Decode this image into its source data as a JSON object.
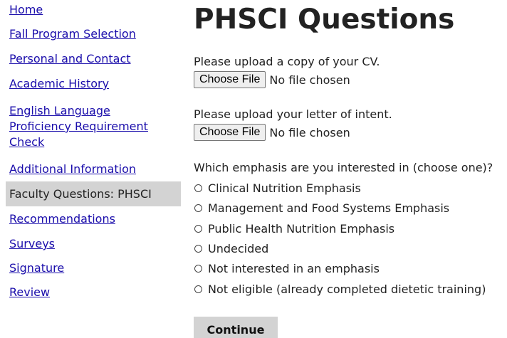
{
  "sidebar": {
    "items": [
      {
        "label": "Home",
        "active": false
      },
      {
        "label": "Fall Program Selection",
        "active": false
      },
      {
        "label": "Personal and Contact",
        "active": false
      },
      {
        "label": "Academic History",
        "active": false
      },
      {
        "label": "English Language Proficiency Requirement Check",
        "active": false
      },
      {
        "label": "Additional Information",
        "active": false
      },
      {
        "label": "Faculty Questions: PHSCI",
        "active": true
      },
      {
        "label": "Recommendations",
        "active": false
      },
      {
        "label": "Surveys",
        "active": false
      },
      {
        "label": "Signature",
        "active": false
      },
      {
        "label": "Review",
        "active": false
      }
    ],
    "english_lines": [
      "English Language",
      "Proficiency Requirement",
      "Check"
    ]
  },
  "main": {
    "title": "PHSCI Questions",
    "cv_upload": {
      "label": "Please upload a copy of your CV.",
      "button_label": "Choose File",
      "status": "No file chosen"
    },
    "intent_upload": {
      "label": "Please upload your letter of intent.",
      "button_label": "Choose File",
      "status": "No file chosen"
    },
    "emphasis": {
      "question": "Which emphasis are you interested in (choose one)?",
      "options": [
        "Clinical Nutrition Emphasis",
        "Management and Food Systems Emphasis",
        "Public Health Nutrition Emphasis",
        "Undecided",
        "Not interested in an emphasis",
        "Not eligible (already completed dietetic training)"
      ]
    },
    "continue_label": "Continue"
  },
  "colors": {
    "link": "#1a0dab",
    "active_bg": "#d3d3d3",
    "button_bg": "#d3d3d3"
  }
}
